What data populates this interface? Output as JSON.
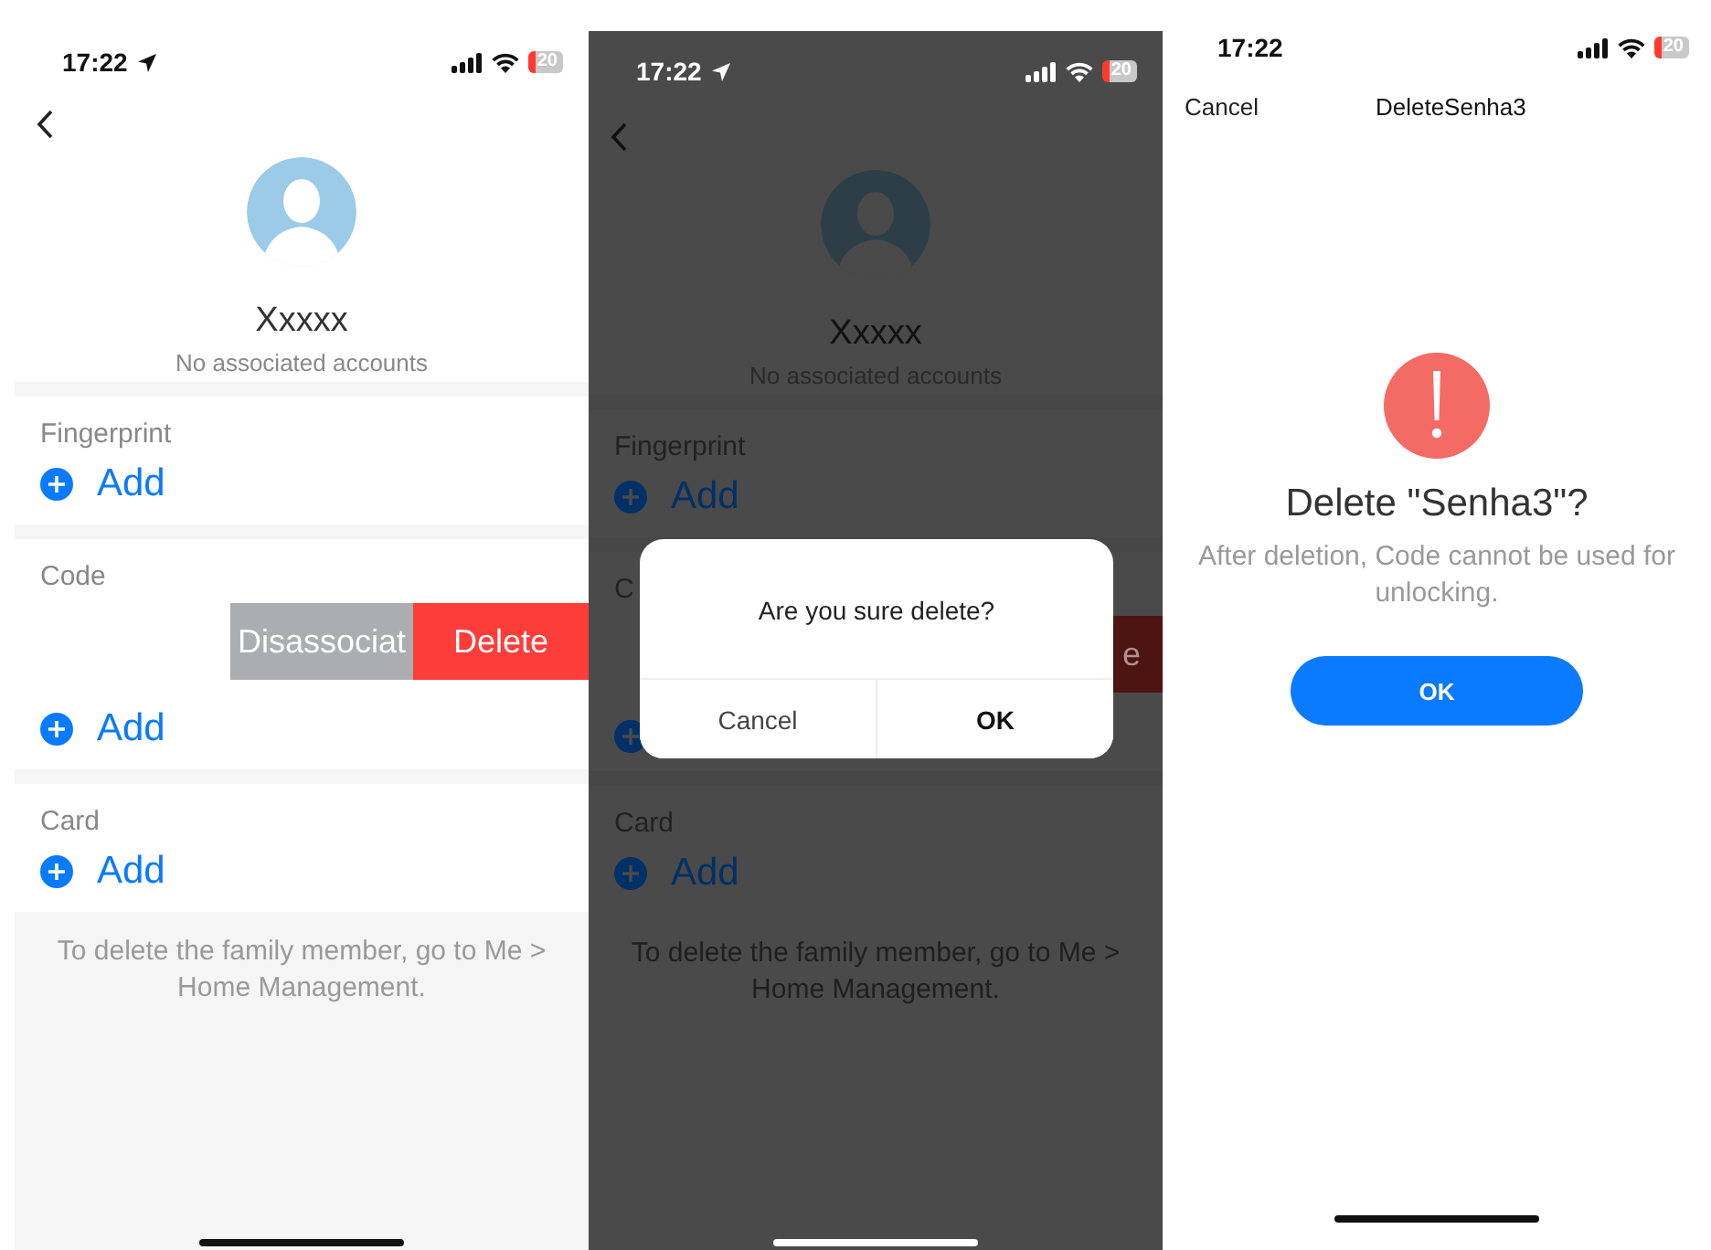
{
  "screens": [
    {
      "kind": "member",
      "dimmed": false,
      "status_bar": {
        "time": "17:22",
        "battery": "20",
        "location": true
      },
      "name": "Xxxxx",
      "subtitle": "No associated accounts",
      "sections": [
        {
          "label": "Fingerprint",
          "add": "Add"
        },
        {
          "label": "Code",
          "swipe_actions": [
            {
              "kind": "neutral",
              "label": "Disassociat"
            },
            {
              "kind": "destructive",
              "label": "Delete"
            }
          ],
          "add": "Add"
        },
        {
          "label": "Card",
          "add": "Add"
        }
      ],
      "note": "To delete the family member, go to Me > Home Management."
    },
    {
      "kind": "member",
      "dimmed": true,
      "status_bar": {
        "time": "17:22",
        "battery": "20",
        "location": true
      },
      "name": "Xxxxx",
      "subtitle": "No associated accounts",
      "sections": [
        {
          "label": "Fingerprint",
          "add": "Add"
        },
        {
          "label": "C",
          "swipe_actions": [
            {
              "kind": "destructive",
              "label": "e"
            }
          ]
        },
        {
          "label": "Card",
          "add": "Add"
        }
      ],
      "note": "To delete the family member, go to Me > Home Management.",
      "dialog": {
        "message": "Are you sure delete?",
        "buttons": [
          {
            "label": "Cancel",
            "primary": false
          },
          {
            "label": "OK",
            "primary": true
          }
        ]
      }
    },
    {
      "kind": "confirm",
      "status_bar": {
        "time": "17:22",
        "battery": "20",
        "location": false
      },
      "nav": {
        "cancel": "Cancel",
        "title": "DeleteSenha3"
      },
      "title": "Delete \"Senha3\"?",
      "message": "After deletion, Code cannot be used for unlocking.",
      "button": "OK"
    }
  ]
}
